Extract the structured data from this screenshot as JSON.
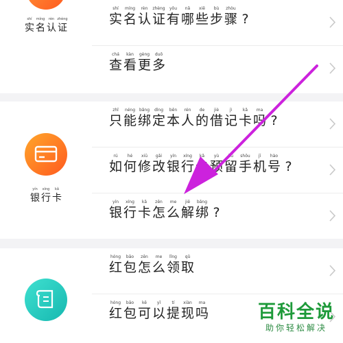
{
  "sections": [
    {
      "label": [
        {
          "c": "实",
          "p": "shí"
        },
        {
          "c": "名",
          "p": "míng"
        },
        {
          "c": "认",
          "p": "rèn"
        },
        {
          "c": "证",
          "p": "zhèng"
        }
      ],
      "items": [
        [
          {
            "c": "实",
            "p": "shí"
          },
          {
            "c": "名",
            "p": "míng"
          },
          {
            "c": "认",
            "p": "rèn"
          },
          {
            "c": "证",
            "p": "zhèng"
          },
          {
            "c": "有",
            "p": "yǒu"
          },
          {
            "c": "哪",
            "p": "nǎ"
          },
          {
            "c": "些",
            "p": "xiē"
          },
          {
            "c": "步",
            "p": "bù"
          },
          {
            "c": "骤",
            "p": "zhòu"
          },
          {
            "c": "?",
            "p": ""
          }
        ],
        [
          {
            "c": "查",
            "p": "chá"
          },
          {
            "c": "看",
            "p": "kàn"
          },
          {
            "c": "更",
            "p": "gèng"
          },
          {
            "c": "多",
            "p": "duō"
          }
        ]
      ]
    },
    {
      "label": [
        {
          "c": "银",
          "p": "yín"
        },
        {
          "c": "行",
          "p": "xíng"
        },
        {
          "c": "卡",
          "p": "kǎ"
        }
      ],
      "icon": "bank-card-icon",
      "icon_colors": [
        "#ffa62b",
        "#ff5a1f"
      ],
      "items": [
        [
          {
            "c": "只",
            "p": "zhǐ"
          },
          {
            "c": "能",
            "p": "néng"
          },
          {
            "c": "绑",
            "p": "bǎng"
          },
          {
            "c": "定",
            "p": "dìng"
          },
          {
            "c": "本",
            "p": "běn"
          },
          {
            "c": "人",
            "p": "rén"
          },
          {
            "c": "的",
            "p": "de"
          },
          {
            "c": "借",
            "p": "jiè"
          },
          {
            "c": "记",
            "p": "jì"
          },
          {
            "c": "卡",
            "p": "kǎ"
          },
          {
            "c": "吗",
            "p": "ma"
          },
          {
            "c": "?",
            "p": ""
          }
        ],
        [
          {
            "c": "如",
            "p": "rú"
          },
          {
            "c": "何",
            "p": "hé"
          },
          {
            "c": "修",
            "p": "xiū"
          },
          {
            "c": "改",
            "p": "gǎi"
          },
          {
            "c": "银",
            "p": "yín"
          },
          {
            "c": "行",
            "p": "xíng"
          },
          {
            "c": "卡",
            "p": "kǎ"
          },
          {
            "c": "预",
            "p": "yù"
          },
          {
            "c": "留",
            "p": "liú"
          },
          {
            "c": "手",
            "p": "shǒu"
          },
          {
            "c": "机",
            "p": "jī"
          },
          {
            "c": "号",
            "p": "hào"
          },
          {
            "c": "?",
            "p": ""
          }
        ],
        [
          {
            "c": "银",
            "p": "yín"
          },
          {
            "c": "行",
            "p": "xíng"
          },
          {
            "c": "卡",
            "p": "kǎ"
          },
          {
            "c": "怎",
            "p": "zěn"
          },
          {
            "c": "么",
            "p": "me"
          },
          {
            "c": "解",
            "p": "jiě"
          },
          {
            "c": "绑",
            "p": "bǎng"
          },
          {
            "c": "?",
            "p": ""
          }
        ]
      ]
    },
    {
      "label": [],
      "icon": "scroll-icon",
      "icon_colors": [
        "#3fe0d0",
        "#16b8b0"
      ],
      "items": [
        [
          {
            "c": "红",
            "p": "hóng"
          },
          {
            "c": "包",
            "p": "bāo"
          },
          {
            "c": "怎",
            "p": "zěn"
          },
          {
            "c": "么",
            "p": "me"
          },
          {
            "c": "领",
            "p": "lǐng"
          },
          {
            "c": "取",
            "p": "qǔ"
          }
        ],
        [
          {
            "c": "红",
            "p": "hóng"
          },
          {
            "c": "包",
            "p": "bāo"
          },
          {
            "c": "可",
            "p": "kě"
          },
          {
            "c": "以",
            "p": "yǐ"
          },
          {
            "c": "提",
            "p": "tí"
          },
          {
            "c": "现",
            "p": "xiàn"
          },
          {
            "c": "吗",
            "p": "ma"
          }
        ]
      ]
    }
  ],
  "first_icon_color": "#ff5a1f",
  "annotation_color": "#cc22dd",
  "watermark": {
    "title": "百科全说",
    "subtitle": "助你轻松解决"
  }
}
